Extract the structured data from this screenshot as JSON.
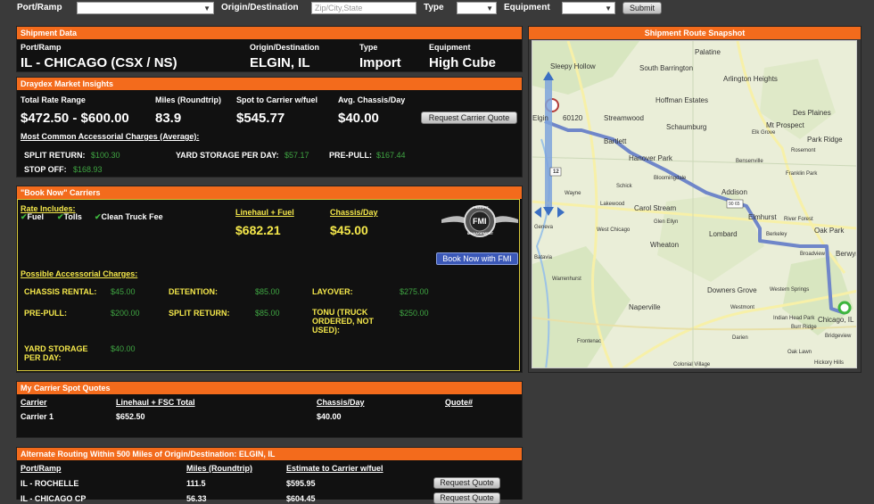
{
  "topbar": {
    "port_label": "Port/Ramp",
    "origin_label": "Origin/Destination",
    "origin_placeholder": "Zip/City,State",
    "type_label": "Type",
    "equipment_label": "Equipment",
    "submit_label": "Submit"
  },
  "shipment": {
    "header": "Shipment Data",
    "cols": {
      "port_ramp": "Port/Ramp",
      "origin_destination": "Origin/Destination",
      "type": "Type",
      "equipment": "Equipment"
    },
    "values": {
      "port_ramp": "IL - CHICAGO (CSX / NS)",
      "origin_destination": "ELGIN, IL",
      "type": "Import",
      "equipment": "High Cube"
    }
  },
  "insights": {
    "header": "Draydex Market Insights",
    "labels": {
      "total_rate": "Total Rate Range",
      "miles": "Miles (Roundtrip)",
      "spot": "Spot to Carrier w/fuel",
      "chassis": "Avg. Chassis/Day"
    },
    "values": {
      "total_rate": "$472.50 - $600.00",
      "miles": "83.9",
      "spot": "$545.77",
      "chassis": "$40.00"
    },
    "quote_button": "Request Carrier Quote",
    "accessorial_title": "Most Common Accessorial Charges (Average):",
    "charges": [
      {
        "label": "SPLIT RETURN:",
        "value": "$100.30"
      },
      {
        "label": "YARD STORAGE PER DAY:",
        "value": "$57.17"
      },
      {
        "label": "PRE-PULL:",
        "value": "$167.44"
      },
      {
        "label": "STOP OFF:",
        "value": "$168.93"
      }
    ]
  },
  "book_now": {
    "header": "\"Book Now\" Carriers",
    "rate_includes": "Rate Includes:",
    "includes": [
      "Fuel",
      "Tolls",
      "Clean Truck Fee"
    ],
    "linehaul_label": "Linehaul + Fuel",
    "chassis_label": "Chassis/Day",
    "linehaul_value": "$682.21",
    "chassis_value": "$45.00",
    "logo_top": "FREIGHT",
    "logo_mid": "FMI",
    "logo_bottom": "MANAGEMENT",
    "book_button": "Book Now with FMI",
    "possible_title": "Possible Accessorial Charges:",
    "charges": [
      {
        "label": "CHASSIS RENTAL:",
        "value": "$45.00"
      },
      {
        "label": "DETENTION:",
        "value": "$85.00"
      },
      {
        "label": "LAYOVER:",
        "value": "$275.00"
      },
      {
        "label": "PRE-PULL:",
        "value": "$200.00"
      },
      {
        "label": "SPLIT RETURN:",
        "value": "$85.00"
      },
      {
        "label": "TONU (TRUCK ORDERED, NOT USED):",
        "value": "$250.00"
      },
      {
        "label": "YARD STORAGE PER DAY:",
        "value": "$40.00"
      }
    ]
  },
  "spot_quotes": {
    "header": "My Carrier Spot Quotes",
    "cols": [
      "Carrier",
      "Linehaul + FSC Total",
      "Chassis/Day",
      "Quote#"
    ],
    "rows": [
      {
        "carrier": "Carrier 1",
        "linehaul": "$652.50",
        "chassis": "$40.00",
        "quote": ""
      }
    ]
  },
  "alternate": {
    "header": "Alternate Routing Within 500 Miles of Origin/Destination: ELGIN, IL",
    "cols": [
      "Port/Ramp",
      "Miles (Roundtrip)",
      "Estimate to Carrier w/fuel"
    ],
    "rows": [
      {
        "port": "IL - ROCHELLE",
        "miles": "111.5",
        "estimate": "$595.95",
        "button": "Request Quote"
      },
      {
        "port": "IL - CHICAGO CP",
        "miles": "56.33",
        "estimate": "$604.45",
        "button": "Request Quote"
      }
    ]
  },
  "map": {
    "header": "Shipment Route Snapshot",
    "route_color": "#6f86c9",
    "places": [
      "Palatine",
      "Sleepy Hollow",
      "South Barrington",
      "Arlington Heights",
      "Hoffman Estates",
      "60120",
      "Elgin",
      "Streamwood",
      "Schaumburg",
      "Des Plaines",
      "Mt Prospect",
      "Elk Grove",
      "Park Ridge",
      "Bartlett",
      "Hanover Park",
      "Bensenville",
      "Rosemont",
      "Bloomingdale",
      "Schick",
      "Addison",
      "Franklin Park",
      "Wayne",
      "Elmhurst",
      "Lakewood",
      "Carol Stream",
      "River Forest",
      "Oak Park",
      "Glen Ellyn",
      "Lombard",
      "Berkeley",
      "Geneva",
      "West Chicago",
      "Wheaton",
      "Broadview",
      "Berwyn",
      "Batavia",
      "Warrenhurst",
      "Downers Grove",
      "Western Springs",
      "Naperville",
      "Westmont",
      "Indian Head Park",
      "Chicago, IL",
      "Burr Ridge",
      "Bridgeview",
      "Frontenac",
      "Darien",
      "Hickory Hills",
      "Colonial Village",
      "Oak Lawn"
    ],
    "shield_12": "12",
    "shield_9065": "90 65"
  }
}
